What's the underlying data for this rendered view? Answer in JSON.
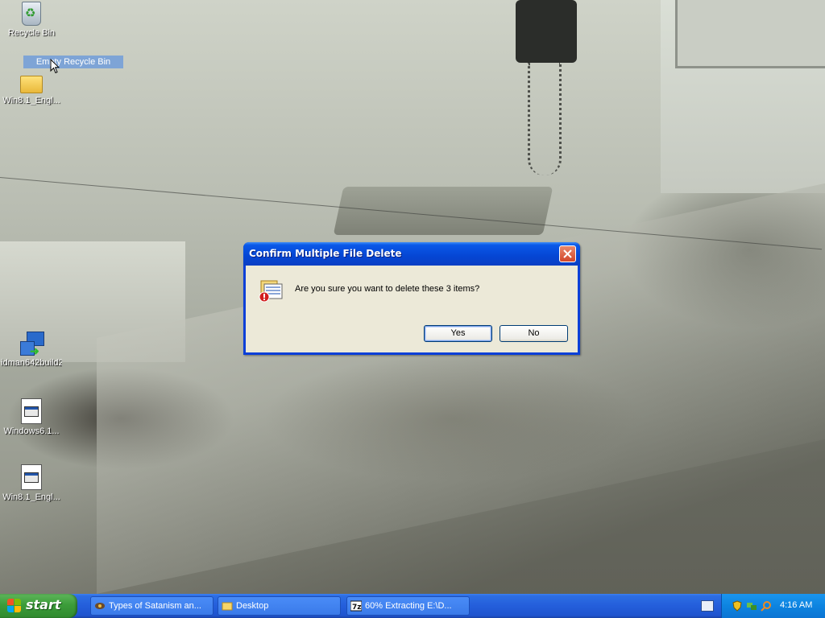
{
  "desktop": {
    "icons": [
      {
        "label": "Recycle Bin",
        "icon": "recycle-bin-icon"
      },
      {
        "label": "Win8.1_Engl...",
        "icon": "folder-icon"
      },
      {
        "label": "idman642build2",
        "icon": "installer-icon"
      },
      {
        "label": "Windows6.1...",
        "icon": "update-package-icon"
      },
      {
        "label": "Win8.1_Engl...",
        "icon": "update-package-icon"
      }
    ],
    "context_label": "Empty Recycle Bin"
  },
  "dialog": {
    "title": "Confirm Multiple File Delete",
    "message": "Are you sure you want to delete these 3 items?",
    "yes_label": "Yes",
    "no_label": "No",
    "icon": "delete-files-warning-icon"
  },
  "taskbar": {
    "start_label": "start",
    "tasks": [
      {
        "label": "Types of Satanism an...",
        "icon": "browser-icon"
      },
      {
        "label": "Desktop",
        "icon": "folder-icon"
      },
      {
        "label": "60% Extracting E:\\D...",
        "icon": "7zip-icon"
      }
    ],
    "clock": "4:16 AM"
  },
  "colors": {
    "title_blue": "#0546d4",
    "taskbar_blue": "#245edb",
    "start_green": "#3c9c3a",
    "dialog_face": "#ece9d8"
  }
}
